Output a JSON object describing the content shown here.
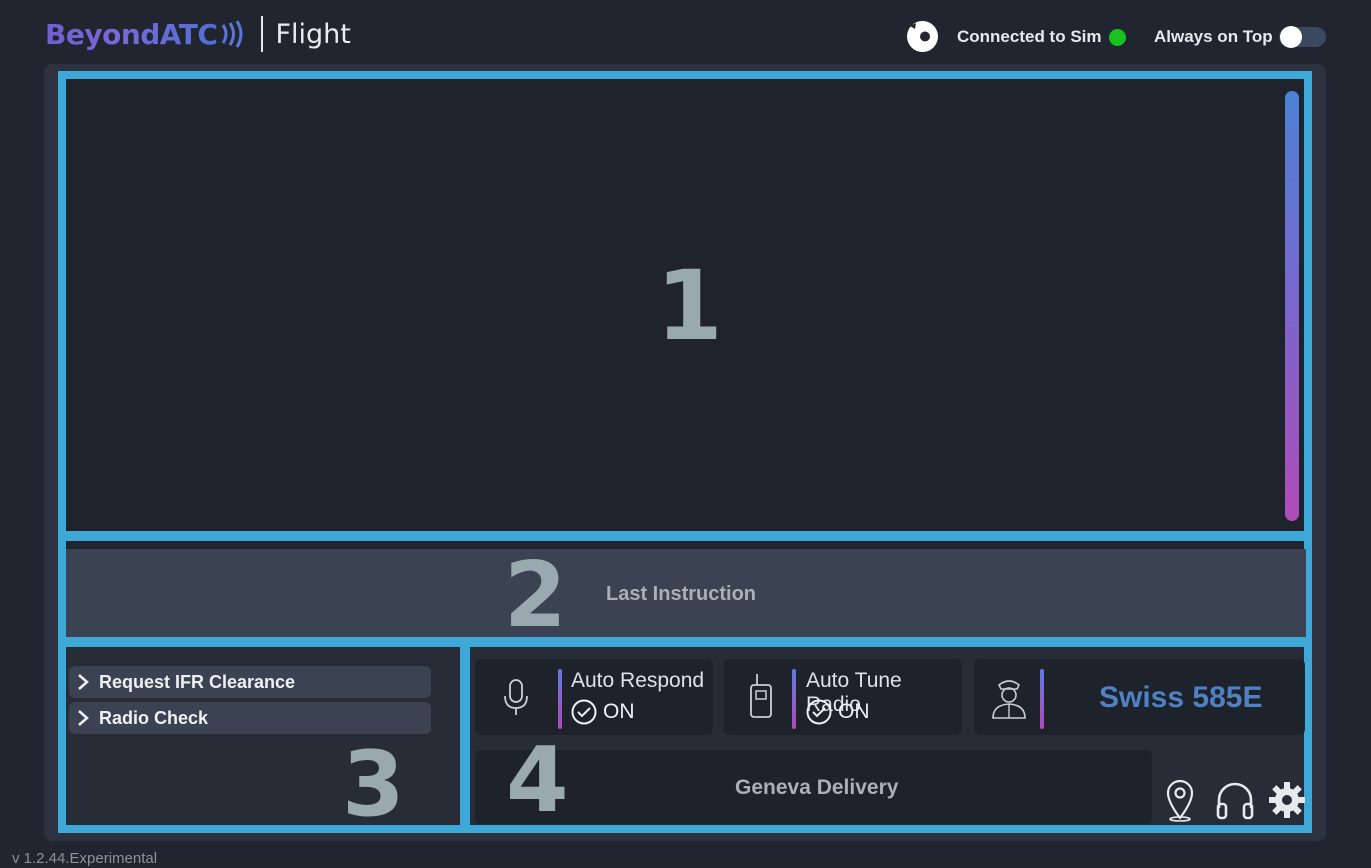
{
  "header": {
    "brand": "BeyondATC",
    "product": "Flight",
    "status_label": "Connected to Sim",
    "status_color": "#17c21f",
    "always_on_top_label": "Always on Top",
    "always_on_top_enabled": false
  },
  "region_labels": [
    "1",
    "2",
    "3",
    "4"
  ],
  "last_instruction": {
    "label": "Last Instruction"
  },
  "actions": [
    {
      "label": "Request IFR Clearance",
      "icon": "chevron-right-icon"
    },
    {
      "label": "Radio Check",
      "icon": "chevron-right-icon"
    }
  ],
  "cards": {
    "auto_respond": {
      "title": "Auto Respond",
      "state": "ON",
      "icon": "microphone-icon"
    },
    "auto_tune": {
      "title": "Auto Tune Radio",
      "state": "ON",
      "icon": "radio-icon"
    },
    "pilot": {
      "callsign": "Swiss 585E",
      "icon": "pilot-icon"
    }
  },
  "frequency": {
    "label": "Geneva Delivery"
  },
  "tools": [
    "map-pin-icon",
    "headphones-icon",
    "gear-icon"
  ],
  "version": "v 1.2.44.Experimental",
  "colors": {
    "accent_border": "#3ea8d8",
    "callsign": "#4f82c5",
    "background": "#21252f"
  }
}
